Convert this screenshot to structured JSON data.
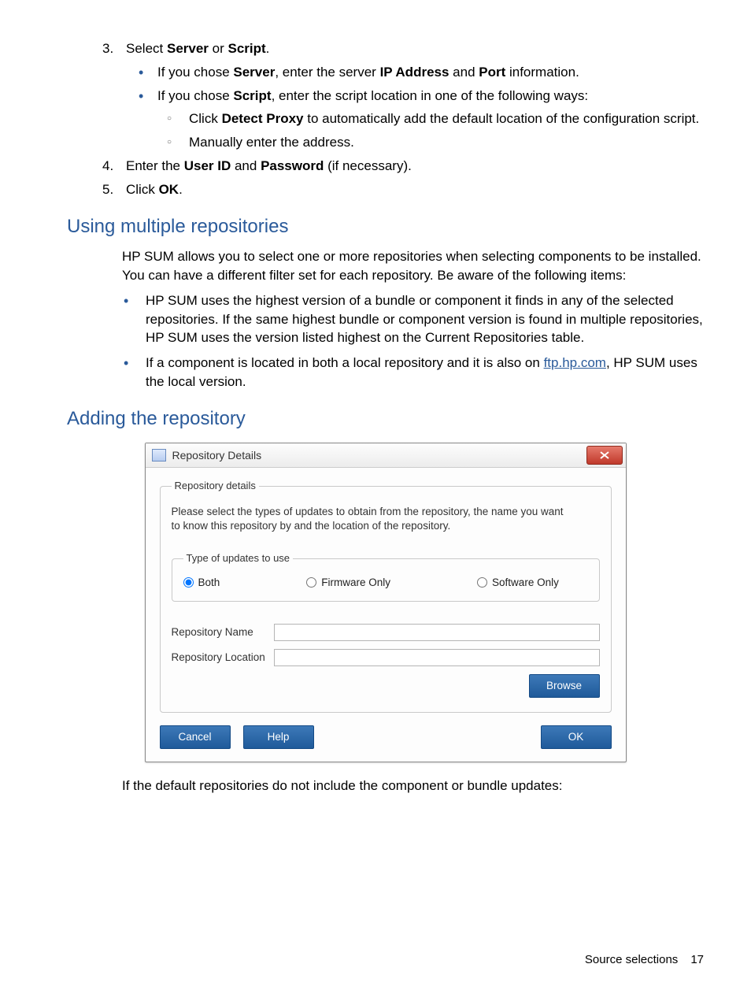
{
  "steps": {
    "s3": {
      "num": "3.",
      "pre": "Select ",
      "b1": "Server",
      "mid": " or ",
      "b2": "Script",
      "post": "."
    },
    "s3a": {
      "pre": "If you chose ",
      "b1": "Server",
      "mid": ", enter the server ",
      "b2": "IP Address",
      "mid2": " and ",
      "b3": "Port",
      "post": " information."
    },
    "s3b": {
      "pre": "If you chose ",
      "b1": "Script",
      "post": ", enter the script location in one of the following ways:"
    },
    "s3b1": {
      "pre": "Click ",
      "b1": "Detect Proxy",
      "post": " to automatically add the default location of the configuration script."
    },
    "s3b2": "Manually enter the address.",
    "s4": {
      "num": "4.",
      "pre": "Enter the ",
      "b1": "User ID",
      "mid": " and ",
      "b2": "Password",
      "post": " (if necessary)."
    },
    "s5": {
      "num": "5.",
      "pre": "Click ",
      "b1": "OK",
      "post": "."
    }
  },
  "section1": {
    "title": "Using multiple repositories",
    "para": "HP SUM allows you to select one or more repositories when selecting components to be installed. You can have a different filter set for each repository. Be aware of the following items:",
    "b1": "HP SUM uses the highest version of a bundle or component it finds in any of the selected repositories. If the same highest bundle or component version is found in multiple repositories, HP SUM uses the version listed highest on the Current Repositories table.",
    "b2_pre": "If a component is located in both a local repository and it is also on ",
    "b2_link": "ftp.hp.com",
    "b2_post": ", HP SUM uses the local version."
  },
  "section2": {
    "title": "Adding the repository"
  },
  "dialog": {
    "title": "Repository Details",
    "legend_outer": "Repository details",
    "instructions": "Please select the types of updates to obtain from the repository, the name you want to know this repository by and the location of the repository.",
    "legend_inner": "Type of updates to use",
    "radio_both": "Both",
    "radio_fw": "Firmware Only",
    "radio_sw": "Software Only",
    "lbl_name": "Repository Name",
    "lbl_loc": "Repository Location",
    "btn_browse": "Browse",
    "btn_cancel": "Cancel",
    "btn_help": "Help",
    "btn_ok": "OK"
  },
  "after_dialog": "If the default repositories do not include the component or bundle updates:",
  "footer": {
    "text": "Source selections",
    "page": "17"
  }
}
